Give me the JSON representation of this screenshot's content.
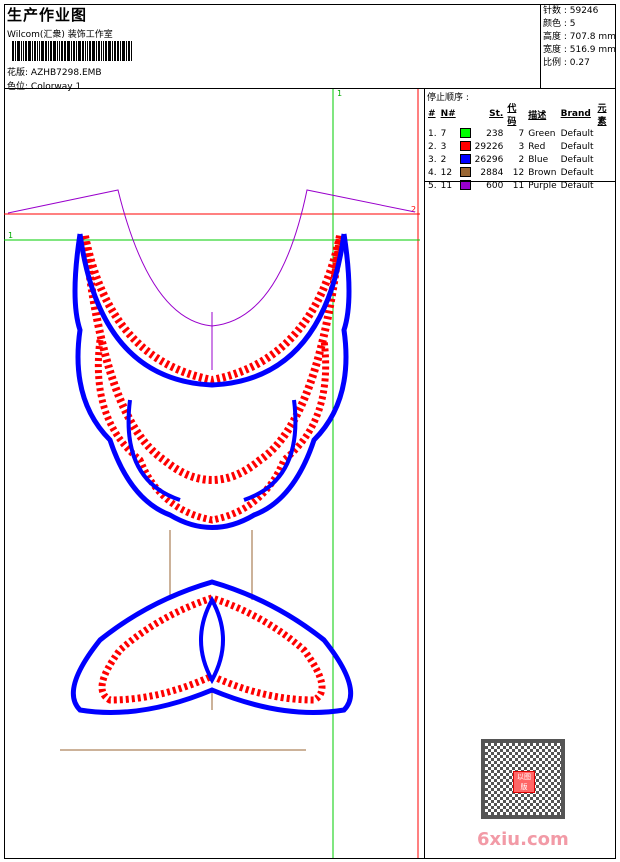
{
  "header": {
    "title": "生产作业图",
    "company": "Wilcom(汇衆) 装饰工作室",
    "design_label": "花版:",
    "design_value": "AZHB7298.EMB",
    "colorway_label": "色位:",
    "colorway_value": "Colorway 1"
  },
  "stats": {
    "stitches": "针数 : 59246",
    "colors": "颜色 : 5",
    "height": "高度 : 707.8 mm",
    "width": "宽度 : 516.9 mm",
    "scale": "比例 : 0.27"
  },
  "stop_sequence": {
    "title": "停止顺序 :",
    "headers": [
      "#",
      "N#",
      "",
      "St.",
      "代码",
      "描述",
      "Brand",
      "元素"
    ],
    "rows": [
      {
        "idx": "1.",
        "n": "7",
        "color": "#00ff00",
        "st": "238",
        "code": "7",
        "desc": "Green",
        "brand": "Default"
      },
      {
        "idx": "2.",
        "n": "3",
        "color": "#ff0000",
        "st": "29226",
        "code": "3",
        "desc": "Red",
        "brand": "Default"
      },
      {
        "idx": "3.",
        "n": "2",
        "color": "#0000ff",
        "st": "26296",
        "code": "2",
        "desc": "Blue",
        "brand": "Default"
      },
      {
        "idx": "4.",
        "n": "12",
        "color": "#996633",
        "st": "2884",
        "code": "12",
        "desc": "Brown",
        "brand": "Default"
      },
      {
        "idx": "5.",
        "n": "11",
        "color": "#9900cc",
        "st": "600",
        "code": "11",
        "desc": "Purple",
        "brand": "Default"
      }
    ]
  },
  "markers": {
    "v1": "1",
    "h2": "2",
    "h1": "1"
  },
  "watermark": "6xiu.com",
  "seal": "以图版"
}
